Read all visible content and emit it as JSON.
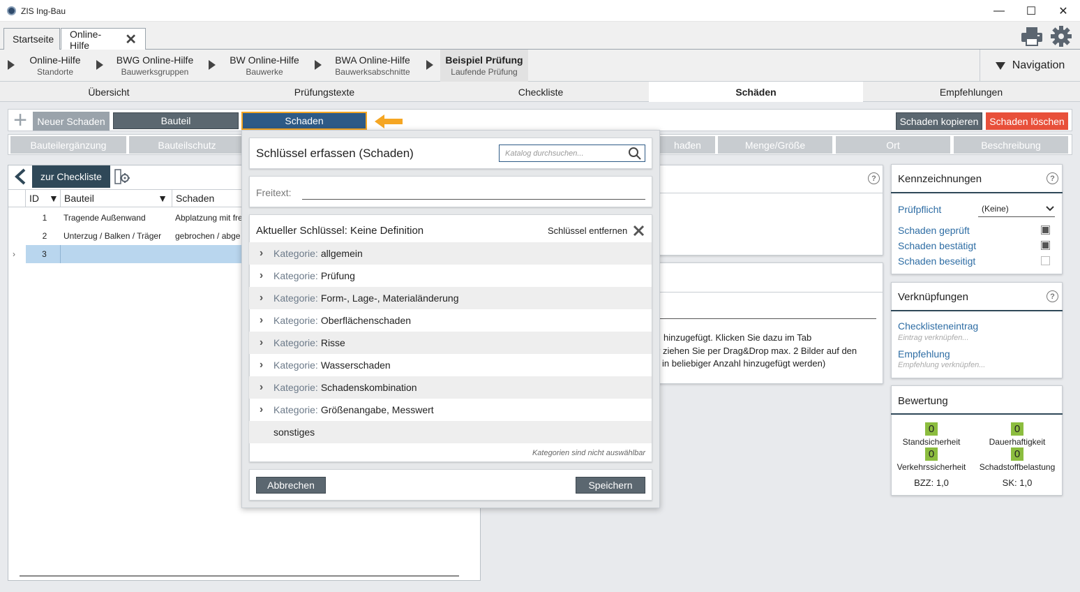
{
  "window": {
    "title": "ZIS Ing-Bau",
    "minimize": "—",
    "maximize": "☐",
    "close": "✕"
  },
  "tabs": [
    {
      "label": "Startseite"
    },
    {
      "label": "Online-Hilfe"
    }
  ],
  "breadcrumbs": [
    {
      "title": "Online-Hilfe",
      "sub": "Standorte"
    },
    {
      "title": "BWG Online-Hilfe",
      "sub": "Bauwerksgruppen"
    },
    {
      "title": "BW Online-Hilfe",
      "sub": "Bauwerke"
    },
    {
      "title": "BWA Online-Hilfe",
      "sub": "Bauwerksabschnitte"
    },
    {
      "title": "Beispiel Prüfung",
      "sub": "Laufende Prüfung"
    }
  ],
  "navigation_label": "Navigation",
  "sections": [
    "Übersicht",
    "Prüfungstexte",
    "Checkliste",
    "Schäden",
    "Empfehlungen"
  ],
  "toolbar": {
    "new_damage": "Neuer Schaden",
    "bauteil": "Bauteil",
    "schaden": "Schaden",
    "copy": "Schaden kopieren",
    "delete": "Schaden löschen"
  },
  "row2": [
    "Bauteilergänzung",
    "Bauteilschutz",
    "hađen",
    "Menge/Größe",
    "Ort",
    "Beschreibung"
  ],
  "left": {
    "back_label": "zur Checkliste",
    "columns": [
      "ID",
      "Bauteil",
      "Schaden"
    ],
    "rows": [
      {
        "id": "1",
        "bauteil": "Tragende Außenwand",
        "schaden": "Abplatzung mit fre"
      },
      {
        "id": "2",
        "bauteil": "Unterzug / Balken / Träger",
        "schaden": "gebrochen / abge"
      },
      {
        "id": "3",
        "bauteil": "",
        "schaden": ""
      }
    ],
    "row_marker": "›"
  },
  "middle_text": [
    "hinzugefügt. Klicken Sie dazu im Tab",
    "r ziehen Sie per Drag&Drop max. 2 Bilder auf den",
    "in beliebiger Anzahl hinzugefügt werden)"
  ],
  "kennzeichnungen": {
    "title": "Kennzeichnungen",
    "pruefpflicht_label": "Prüfpflicht",
    "pruefpflicht_value": "(Keine)",
    "checks": [
      {
        "label": "Schaden geprüft",
        "checked": true
      },
      {
        "label": "Schaden bestätigt",
        "checked": true
      },
      {
        "label": "Schaden beseitigt",
        "checked": false
      }
    ]
  },
  "verknuepfungen": {
    "title": "Verknüpfungen",
    "items": [
      {
        "label": "Checklisteneintrag",
        "sub": "Eintrag verknüpfen..."
      },
      {
        "label": "Empfehlung",
        "sub": "Empfehlung verknüpfen..."
      }
    ]
  },
  "bewertung": {
    "title": "Bewertung",
    "scores": [
      {
        "value": "0",
        "label": "Standsicherheit"
      },
      {
        "value": "0",
        "label": "Dauerhaftigkeit"
      },
      {
        "value": "0",
        "label": "Verkehrssicherheit"
      },
      {
        "value": "0",
        "label": "Schadstoffbelastung"
      }
    ],
    "bzz": "BZZ: 1,0",
    "sk": "SK: 1,0"
  },
  "dialog": {
    "title": "Schlüssel erfassen (Schaden)",
    "search_placeholder": "Katalog durchsuchen...",
    "freitext_label": "Freitext:",
    "current_key": "Aktueller Schlüssel: Keine Definition",
    "remove_key": "Schlüssel entfernen",
    "category_prefix": "Kategorie:",
    "categories": [
      "allgemein",
      "Prüfung",
      "Form-, Lage-, Materialänderung",
      "Oberflächenschaden",
      "Risse",
      "Wasserschaden",
      "Schadenskombination",
      "Größenangabe, Messwert"
    ],
    "other": "sonstiges",
    "hint": "Kategorien sind nicht auswählbar",
    "cancel": "Abbrechen",
    "save": "Speichern"
  },
  "colors": {
    "accent": "#2f4858",
    "selected_blue": "#2e5a86",
    "delete_red": "#e8503a",
    "arrow_orange": "#f5a623",
    "score_green": "#8cbd3f"
  }
}
